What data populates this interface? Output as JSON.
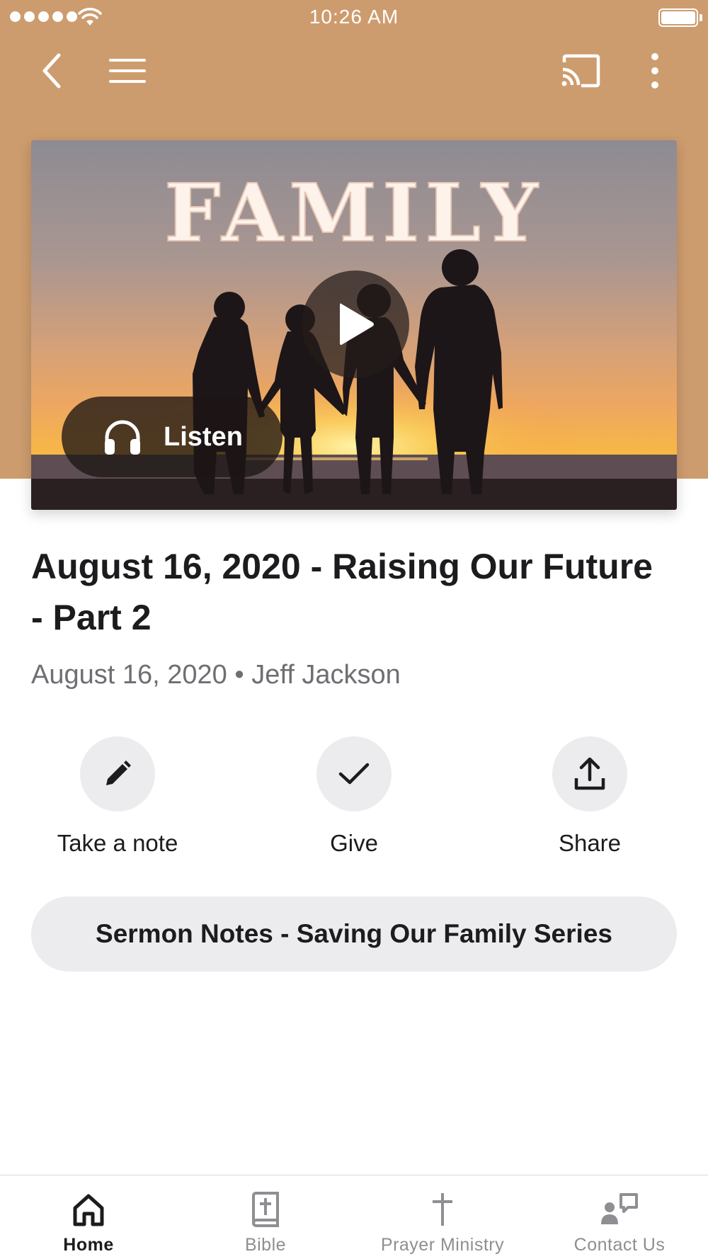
{
  "status_bar": {
    "time": "10:26 AM"
  },
  "colors": {
    "header_bg": "#cd9c6e",
    "action_circle": "#ececee",
    "tab_inactive": "#8e8e93"
  },
  "nav": {
    "back_icon": "chevron-left-icon",
    "menu_icon": "hamburger-menu-icon",
    "cast_icon": "cast-icon",
    "more_icon": "more-vertical-icon"
  },
  "hero": {
    "artwork_title": "FAMILY",
    "play_icon": "play-icon",
    "listen_label": "Listen"
  },
  "sermon": {
    "title": "August 16, 2020 - Raising Our Future - Part 2",
    "meta": "August 16, 2020 • Jeff Jackson"
  },
  "actions": [
    {
      "label": "Take a note",
      "icon": "pencil-icon"
    },
    {
      "label": "Give",
      "icon": "checkmark-icon"
    },
    {
      "label": "Share",
      "icon": "share-upload-icon"
    }
  ],
  "notes_button": {
    "label": "Sermon Notes - Saving Our Family Series"
  },
  "tabbar": {
    "items": [
      {
        "label": "Home",
        "icon": "home-icon",
        "active": true
      },
      {
        "label": "Bible",
        "icon": "bible-icon",
        "active": false
      },
      {
        "label": "Prayer Ministry",
        "icon": "cross-icon",
        "active": false
      },
      {
        "label": "Contact Us",
        "icon": "contact-chat-icon",
        "active": false
      }
    ]
  }
}
